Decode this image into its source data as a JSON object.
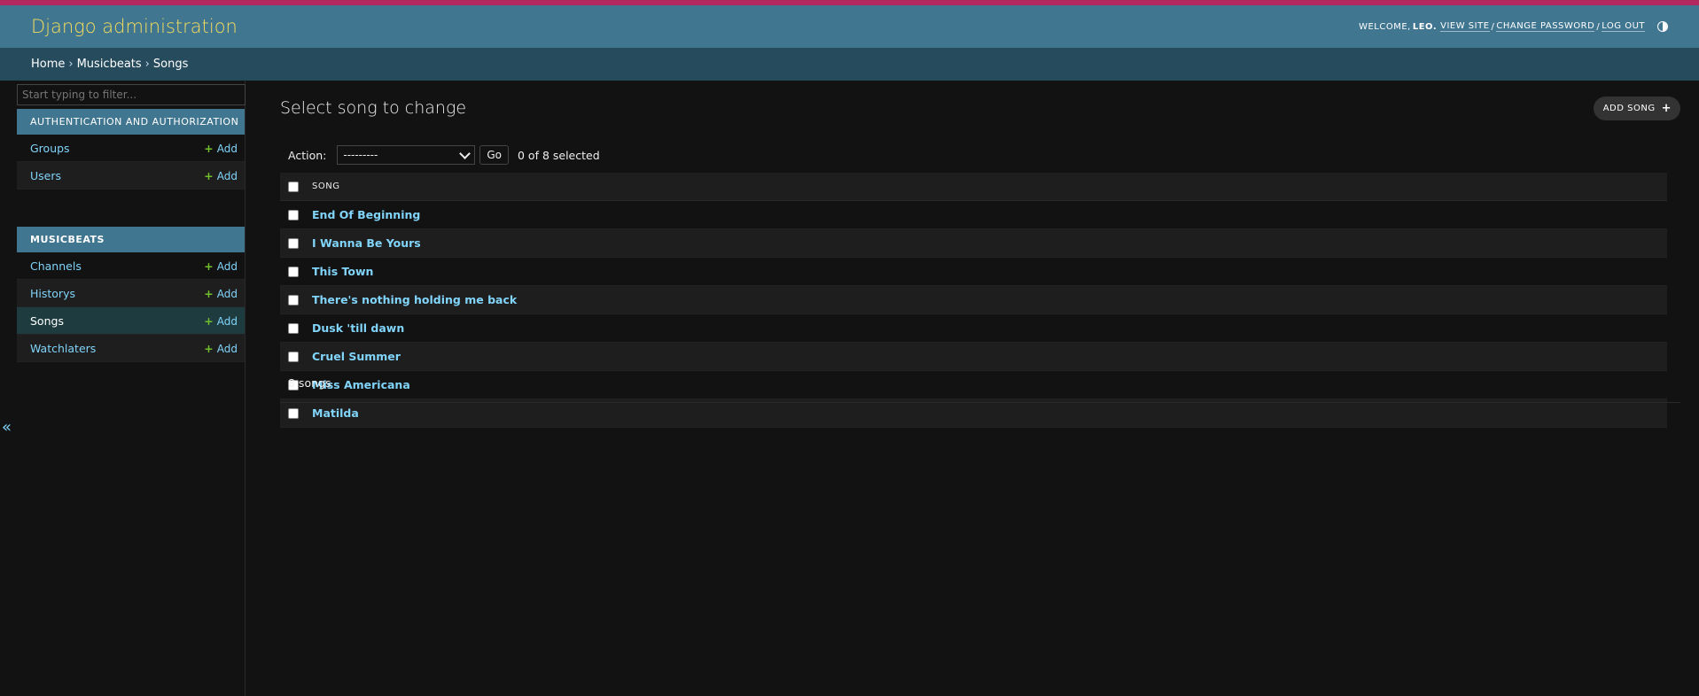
{
  "header": {
    "brand": "Django administration",
    "welcome": "Welcome,",
    "username": "Leo.",
    "view_site": "View site",
    "change_password": "Change password",
    "log_out": "Log out",
    "sep": "/"
  },
  "breadcrumbs": {
    "home": "Home",
    "app": "Musicbeats",
    "current": "Songs",
    "sep": "›"
  },
  "sidebar": {
    "filter_placeholder": "Start typing to filter...",
    "auth_caption": "Authentication and Authorization",
    "auth_items": [
      {
        "label": "Groups",
        "add": "Add"
      },
      {
        "label": "Users",
        "add": "Add"
      }
    ],
    "music_caption": "Musicbeats",
    "music_items": [
      {
        "label": "Channels",
        "add": "Add"
      },
      {
        "label": "Historys",
        "add": "Add"
      },
      {
        "label": "Songs",
        "add": "Add"
      },
      {
        "label": "Watchlaters",
        "add": "Add"
      }
    ],
    "collapse": "«"
  },
  "main": {
    "title": "Select song to change",
    "add_button": "Add song",
    "action_label": "Action:",
    "action_value": "---------",
    "go": "Go",
    "selected": "0 of 8 selected",
    "column": "Song",
    "songs": [
      "End Of Beginning",
      "I Wanna Be Yours",
      "This Town",
      "There's nothing holding me back",
      "Dusk 'till dawn",
      "Cruel Summer",
      "Miss Americana",
      "Matilda"
    ],
    "count": "8 songs"
  },
  "colors": {
    "accent_top": "#b3295f",
    "header": "#417690",
    "breadcrumbs": "#264b5d",
    "link": "#81d4fa",
    "brand": "#f5dd5d",
    "add_plus": "#70bf2b"
  }
}
